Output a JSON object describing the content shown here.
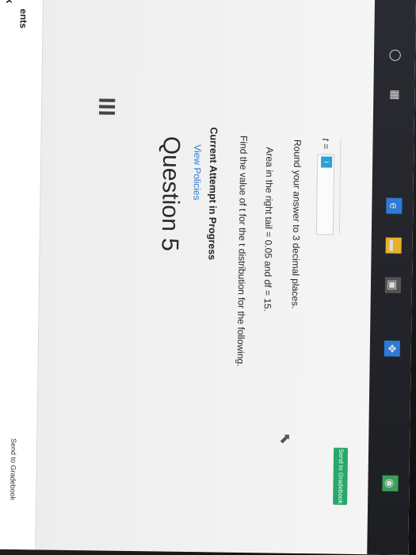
{
  "nav": {
    "item_a": "k",
    "item_b": "ents"
  },
  "header": {
    "send_top": "Send to Gradebook"
  },
  "question": {
    "title": "Question 5",
    "view_policies": "View Policies",
    "attempt": "Current Attempt in Progress",
    "prompt": "Find the value of t for the t distribution for the following.",
    "area": "Area in the right tail = 0.05 and df = 15.",
    "round": "Round your answer to 3 decimal places.",
    "t_label": "t =",
    "input_value": "",
    "badge": "i"
  },
  "footer": {
    "send_button": "Send to Gradebook"
  },
  "taskbar": {
    "icons": [
      "search-circle-icon",
      "task-view-icon",
      "edge-icon",
      "file-explorer-icon",
      "store-icon",
      "dropbox-icon",
      "chrome-icon"
    ]
  }
}
